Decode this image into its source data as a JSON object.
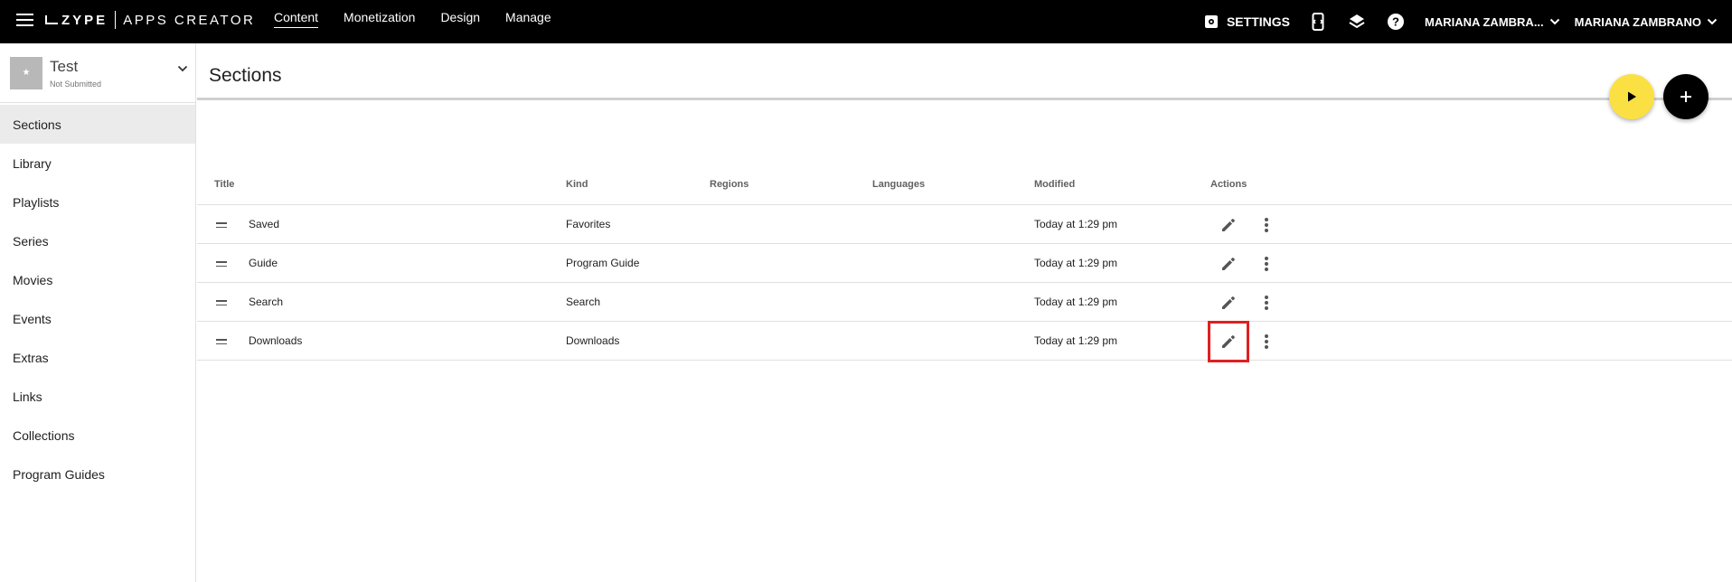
{
  "topbar": {
    "logo_brand": "ZYPE",
    "logo_product": "APPS CREATOR",
    "nav": [
      "Content",
      "Monetization",
      "Design",
      "Manage"
    ],
    "settings_label": "SETTINGS",
    "org_label": "MARIANA ZAMBRA...",
    "user_label": "MARIANA ZAMBRANO"
  },
  "app": {
    "name": "Test",
    "status": "Not Submitted",
    "thumb_glyph": "★"
  },
  "sidebar": {
    "items": [
      {
        "label": "Sections"
      },
      {
        "label": "Library"
      },
      {
        "label": "Playlists"
      },
      {
        "label": "Series"
      },
      {
        "label": "Movies"
      },
      {
        "label": "Events"
      },
      {
        "label": "Extras"
      },
      {
        "label": "Links"
      },
      {
        "label": "Collections"
      },
      {
        "label": "Program Guides"
      }
    ]
  },
  "main": {
    "title": "Sections",
    "columns": {
      "title": "Title",
      "kind": "Kind",
      "regions": "Regions",
      "languages": "Languages",
      "modified": "Modified",
      "actions": "Actions"
    },
    "rows": [
      {
        "title": "Saved",
        "kind": "Favorites",
        "regions": "",
        "languages": "",
        "modified": "Today at 1:29 pm"
      },
      {
        "title": "Guide",
        "kind": "Program Guide",
        "regions": "",
        "languages": "",
        "modified": "Today at 1:29 pm"
      },
      {
        "title": "Search",
        "kind": "Search",
        "regions": "",
        "languages": "",
        "modified": "Today at 1:29 pm"
      },
      {
        "title": "Downloads",
        "kind": "Downloads",
        "regions": "",
        "languages": "",
        "modified": "Today at 1:29 pm"
      }
    ]
  },
  "colors": {
    "topbar_bg": "#000000",
    "preview_fab": "#fbe043",
    "add_fab": "#000000",
    "highlight": "#e02020",
    "active_sidebar_bg": "#ebebeb"
  }
}
